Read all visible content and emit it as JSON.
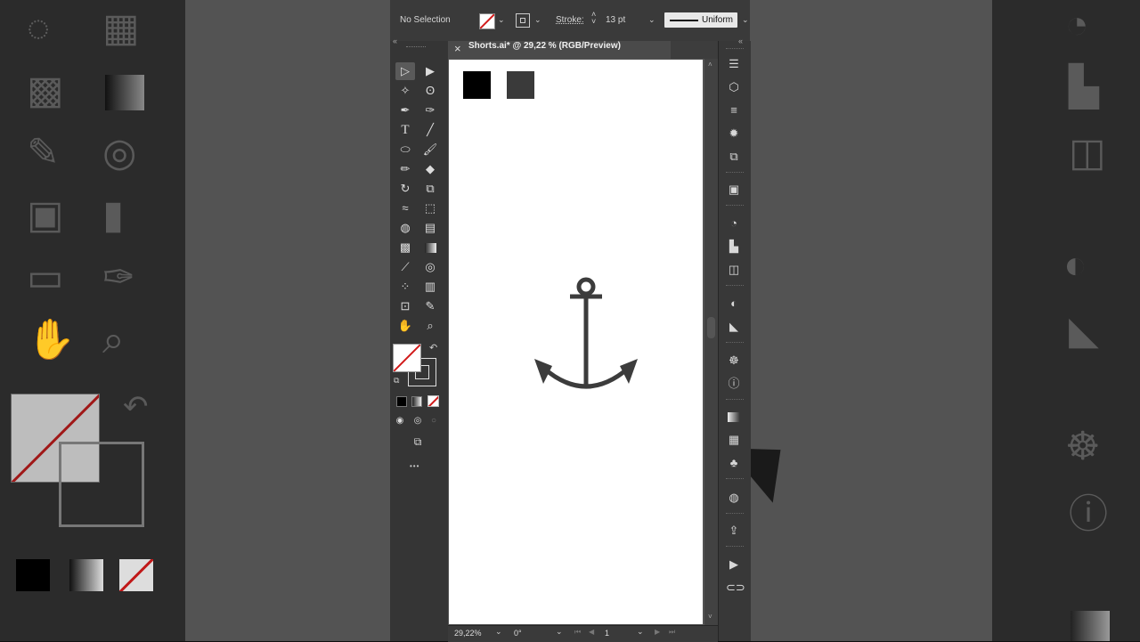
{
  "control_bar": {
    "selection_label": "No Selection",
    "stroke_label": "Stroke:",
    "stroke_weight": "13 pt",
    "profile_label": "Uniform"
  },
  "document_tab": {
    "close_glyph": "×",
    "title": "Shorts.ai* @ 29,22 % (RGB/Preview)"
  },
  "status_bar": {
    "zoom": "29,22%",
    "rotation": "0°",
    "artboard_number": "1"
  },
  "toolbar": {
    "more_glyph": "•••"
  },
  "colors": {
    "swatch_1": "#000000",
    "swatch_2": "#3a3a3a",
    "anchor": "#3c3c3c",
    "ui_dark": "#323232",
    "none_slash": "#d11a1a"
  }
}
